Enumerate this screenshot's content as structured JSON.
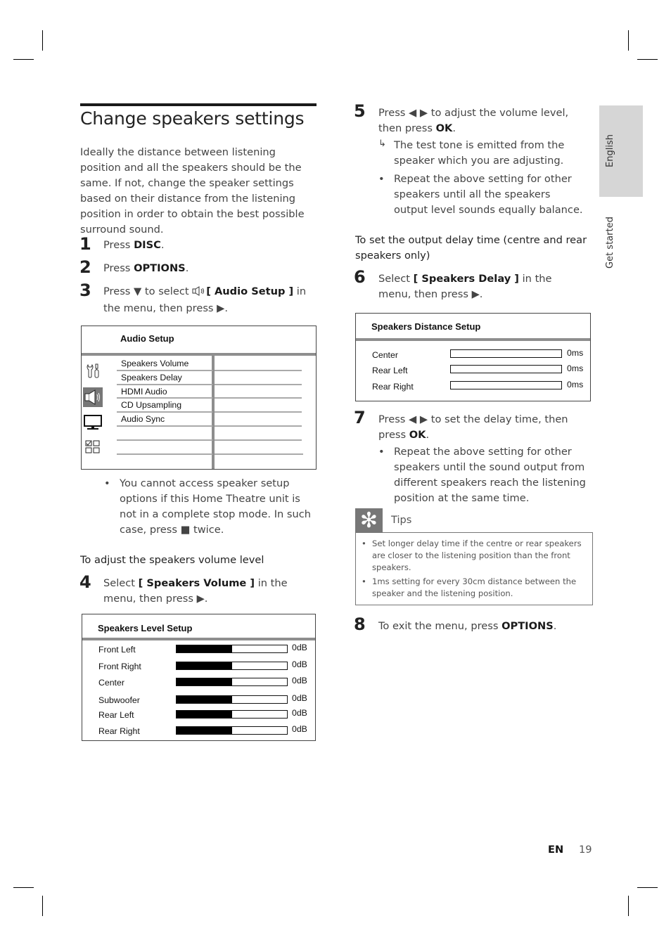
{
  "page": {
    "title": "Change speakers settings",
    "intro": "Ideally the distance between listening position and all the speakers should be the same.  If not, change the speaker settings based on their distance from the listening position in order to obtain the best possible surround sound.",
    "language_code": "EN",
    "page_number": "19"
  },
  "side_tabs": {
    "language": "English",
    "section": "Get started"
  },
  "steps": {
    "s1": {
      "num": "1",
      "pre": "Press ",
      "key": "DISC",
      "post": "."
    },
    "s2": {
      "num": "2",
      "pre": "Press ",
      "key": "OPTIONS",
      "post": "."
    },
    "s3": {
      "num": "3",
      "pre": "Press ▼ to select ",
      "icon": "speaker-icon",
      "key": "[ Audio Setup ]",
      "post": " in the menu, then press ▶."
    },
    "s3_note": "You cannot access speaker setup options if this Home Theatre unit is not in a complete stop mode.  In such case, press ■ twice.",
    "heading_volume": "To adjust the speakers volume level",
    "s4": {
      "num": "4",
      "pre": "Select ",
      "key": "[ Speakers Volume ]",
      "post": " in the menu, then press ▶."
    },
    "s5": {
      "num": "5",
      "pre": "Press ◀ ▶ to adjust the volume level, then press ",
      "key": "OK",
      "post": "."
    },
    "s5_result": "The test tone is emitted from the speaker which you are adjusting.",
    "s5_note": "Repeat the above setting for other speakers until all the speakers output level sounds equally balance.",
    "heading_delay": "To set the output delay time (centre and rear speakers only)",
    "s6": {
      "num": "6",
      "pre": "Select ",
      "key": "[ Speakers Delay ]",
      "post": " in the menu, then press ▶."
    },
    "s7": {
      "num": "7",
      "pre": "Press ◀ ▶ to set the delay time, then press ",
      "key": "OK",
      "post": "."
    },
    "s7_note": "Repeat the above setting for other speakers until the sound output from different speakers reach the listening position at the same time.",
    "s8": {
      "num": "8",
      "pre": "To exit the menu, press ",
      "key": "OPTIONS",
      "post": "."
    }
  },
  "tips": {
    "label": "Tips",
    "items": [
      "Set longer delay time if the centre or rear speakers are closer to the listening position than the front speakers.",
      "1ms setting for every 30cm distance between the speaker and the listening position."
    ]
  },
  "audio_setup_menu": {
    "title": "Audio Setup",
    "side_icons": [
      "general-setup-icon",
      "audio-setup-icon",
      "video-setup-icon",
      "preference-setup-icon"
    ],
    "selected_icon": "audio-setup-icon",
    "items": [
      "Speakers Volume",
      "Speakers Delay",
      "HDMI Audio",
      "CD Upsampling",
      "Audio Sync"
    ]
  },
  "speakers_level_setup": {
    "title": "Speakers Level Setup",
    "rows": [
      {
        "label": "Front Left",
        "value": "0dB",
        "level": 0.5
      },
      {
        "label": "Front Right",
        "value": "0dB",
        "level": 0.5
      },
      {
        "label": "Center",
        "value": "0dB",
        "level": 0.5
      },
      {
        "label": "Subwoofer",
        "value": "0dB",
        "level": 0.5
      },
      {
        "label": "Rear Left",
        "value": "0dB",
        "level": 0.5
      },
      {
        "label": "Rear Right",
        "value": "0dB",
        "level": 0.5
      }
    ]
  },
  "speakers_distance_setup": {
    "title": "Speakers Distance Setup",
    "rows": [
      {
        "label": "Center",
        "value": "0ms",
        "level": 0
      },
      {
        "label": "Rear Left",
        "value": "0ms",
        "level": 0
      },
      {
        "label": "Rear Right",
        "value": "0ms",
        "level": 0
      }
    ]
  }
}
